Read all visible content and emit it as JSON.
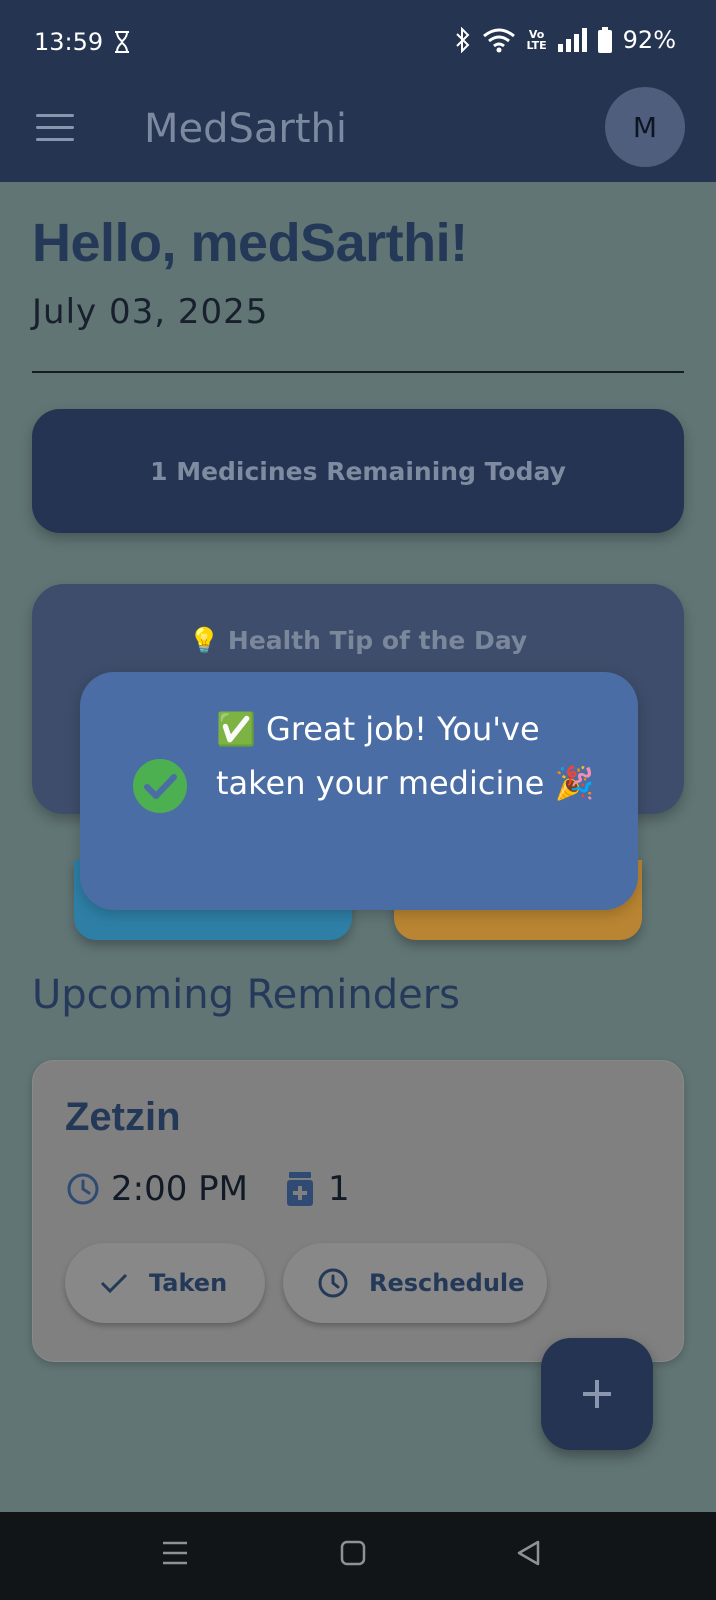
{
  "status_bar": {
    "time": "13:59",
    "battery": "92%",
    "volte_top": "Vo",
    "volte_bottom": "LTE"
  },
  "app_bar": {
    "title": "MedSarthi",
    "avatar_initial": "M",
    "menu_icon": "hamburger-icon"
  },
  "home": {
    "greeting": "Hello, medSarthi!",
    "date": "July 03, 2025",
    "remaining_text": "1 Medicines Remaining Today",
    "tip_title": "Health Tip of the Day",
    "tip_icon": "💡",
    "section_title": "Upcoming Reminders"
  },
  "reminders": [
    {
      "name": "Zetzin",
      "time": "2:00 PM",
      "dose": "1",
      "taken_label": "Taken",
      "reschedule_label": "Reschedule"
    }
  ],
  "toast": {
    "message": "✅ Great job! You've taken your medicine 🎉"
  },
  "colors": {
    "app_bar": "#243451",
    "backdrop": "#617575",
    "toast": "#4a6da5",
    "toast_check": "#4caf50",
    "quick_action_blue": "#2e7fa6",
    "quick_action_orange": "#b98532"
  }
}
